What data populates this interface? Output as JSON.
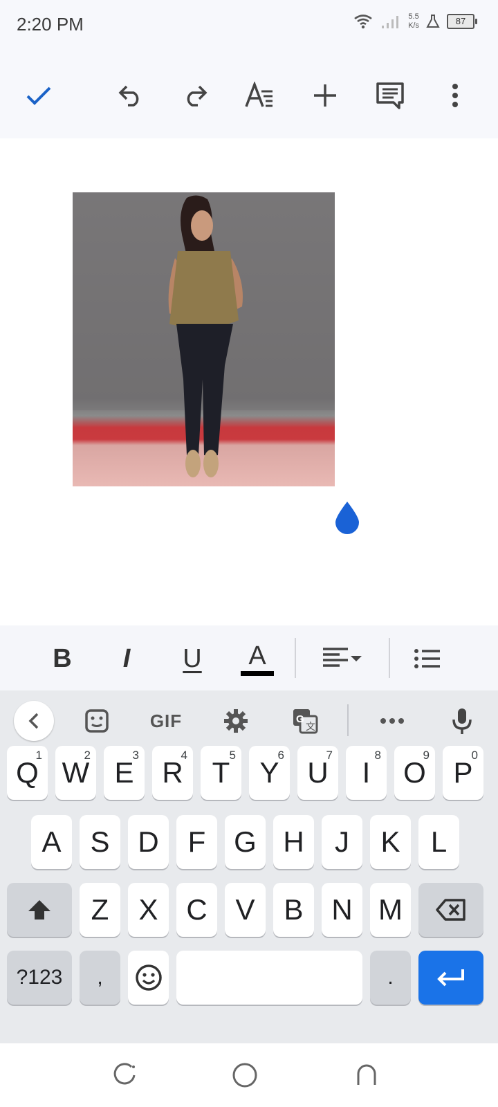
{
  "status": {
    "time": "2:20 PM",
    "net_speed_value": "5.5",
    "net_speed_unit": "K/s",
    "battery": "87"
  },
  "toolbar": {
    "icons": [
      "check-icon",
      "undo-icon",
      "redo-icon",
      "text-format-icon",
      "add-icon",
      "comment-icon",
      "more-vert-icon"
    ]
  },
  "document": {
    "image_alt": "Photo of a woman standing against a grey wall"
  },
  "format_bar": {
    "bold": "B",
    "italic": "I",
    "underline": "U",
    "text_color": "A",
    "text_color_value": "#000000"
  },
  "keyboard": {
    "toolbar_gif": "GIF",
    "row1": [
      {
        "label": "Q",
        "sup": "1"
      },
      {
        "label": "W",
        "sup": "2"
      },
      {
        "label": "E",
        "sup": "3"
      },
      {
        "label": "R",
        "sup": "4"
      },
      {
        "label": "T",
        "sup": "5"
      },
      {
        "label": "Y",
        "sup": "6"
      },
      {
        "label": "U",
        "sup": "7"
      },
      {
        "label": "I",
        "sup": "8"
      },
      {
        "label": "O",
        "sup": "9"
      },
      {
        "label": "P",
        "sup": "0"
      }
    ],
    "row2": [
      "A",
      "S",
      "D",
      "F",
      "G",
      "H",
      "J",
      "K",
      "L"
    ],
    "row3": [
      "Z",
      "X",
      "C",
      "V",
      "B",
      "N",
      "M"
    ],
    "symbols_label": "?123",
    "comma_label": ",",
    "period_label": ".",
    "accent_color": "#1a73e8"
  }
}
